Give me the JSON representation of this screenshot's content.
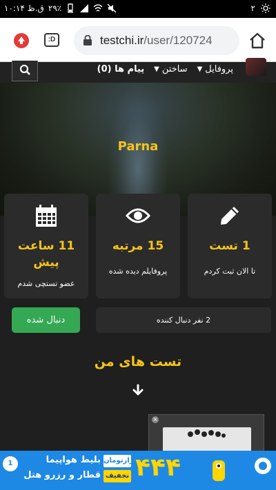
{
  "status_bar": {
    "time": "۱۰:۱۴ ق.ظ",
    "battery": "۲۹٪",
    "notification_count": "۲"
  },
  "browser": {
    "url_host": "testchi.ir",
    "url_path": "/user/120724",
    "tabs_label": ":D"
  },
  "nav": {
    "items": [
      {
        "label": "پروفایل"
      },
      {
        "label": "ساختن"
      },
      {
        "label": "پیام ها (0)"
      }
    ]
  },
  "profile": {
    "username": "Parna"
  },
  "stats": [
    {
      "value": "1 تست",
      "caption": "تا الان ثبت کردم"
    },
    {
      "value": "15 مرتبه",
      "caption": "پروفایلم دیده شده"
    },
    {
      "value": "11 ساعت پیش",
      "caption": "عضو تستچی شدم"
    }
  ],
  "follow": {
    "button_label": "دنبال شده",
    "followers_text": "2 نفر دنبال کننده"
  },
  "section": {
    "title": "تست های من"
  },
  "ad": {
    "number": "۴۴۴",
    "brand": "هزارتومان",
    "discount": "تخفیف",
    "line1": "بلیط هواپیما",
    "line2": "قطار و رزرو هتل",
    "badge": "1"
  },
  "colors": {
    "accent": "#f5c518",
    "follow_green": "#34a853",
    "card_bg": "#2b2b2b",
    "ad_blue": "#1e88e5"
  }
}
